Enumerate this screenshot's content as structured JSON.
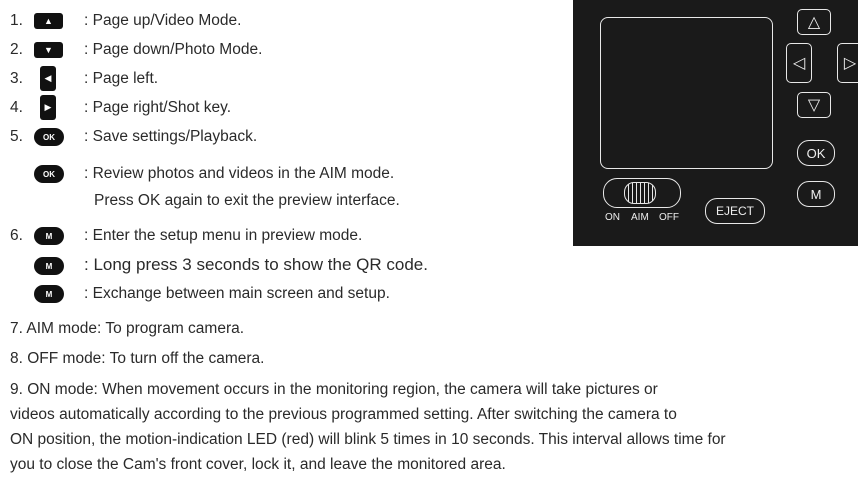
{
  "items": [
    {
      "num": "1.",
      "key": "▲",
      "text": ": Page up/Video Mode."
    },
    {
      "num": "2.",
      "key": "▼",
      "text": ": Page down/Photo Mode."
    },
    {
      "num": "3.",
      "key": "◀",
      "text": ": Page left."
    },
    {
      "num": "4.",
      "key": "▶",
      "text": ": Page right/Shot key."
    },
    {
      "num": "5.",
      "key": "OK",
      "text": ": Save settings/Playback."
    },
    {
      "num": "",
      "key": "OK",
      "text": ": Review photos and videos in the AIM mode."
    },
    {
      "num": "",
      "key": "",
      "text": "Press OK again to exit the preview interface."
    },
    {
      "num": "6.",
      "key": "M",
      "text": ": Enter the setup menu in preview mode."
    },
    {
      "num": "",
      "key": "M",
      "text": ": Long press 3 seconds to show the QR code."
    },
    {
      "num": "",
      "key": "M",
      "text": ": Exchange between main screen and setup."
    }
  ],
  "modes": {
    "aim": "7.   AIM mode: To program camera.",
    "off": "8.   OFF mode: To turn off the camera.",
    "on_l1": "9.   ON mode: When movement occurs in the monitoring region, the camera will take pictures or",
    "on_l2": "videos automatically according to the previous programmed setting. After switching the camera to",
    "on_l3": "ON position, the motion-indication LED (red) will blink 5 times in 10 seconds. This interval allows time for",
    "on_l4": "you to close the Cam's front cover, lock it, and leave the monitored area."
  },
  "panel": {
    "ok": "OK",
    "m": "M",
    "eject": "EJECT",
    "on": "ON",
    "aim": "AIM",
    "off": "OFF",
    "up": "△",
    "down": "▽",
    "left": "◁",
    "right": "▷"
  }
}
